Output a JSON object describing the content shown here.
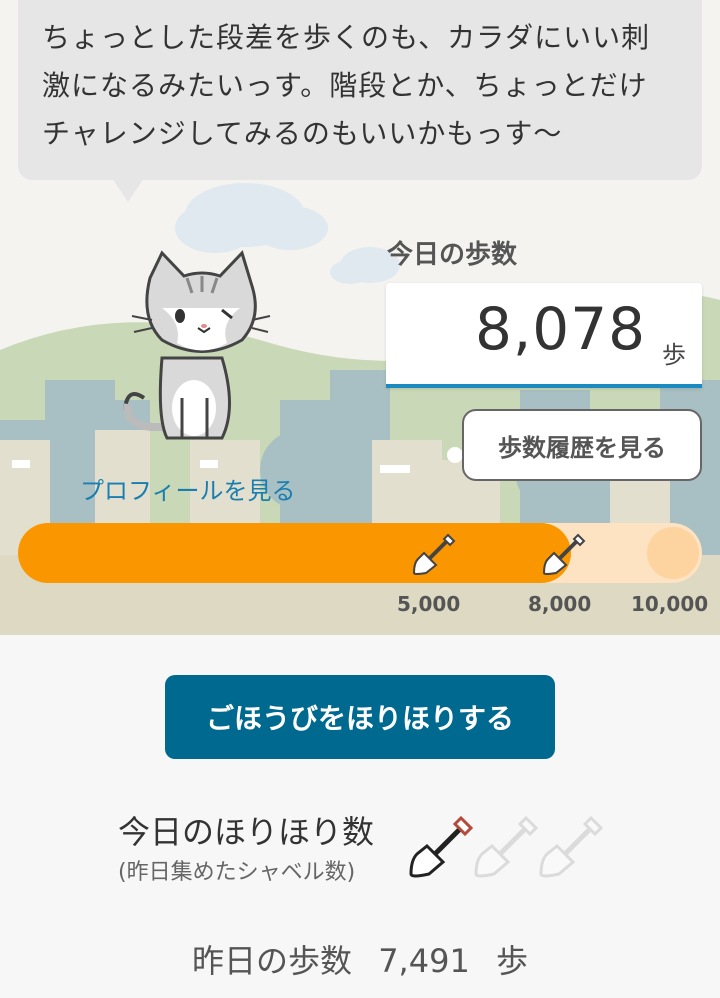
{
  "speech_bubble": {
    "lines": [
      "ちょっとした段差を歩くのも、カラダにいい刺",
      "激になるみたいっす。階段とか、ちょっとだけ",
      "チャレンジしてみるのもいいかもっす〜"
    ]
  },
  "today_steps": {
    "label": "今日の歩数",
    "value": "8,078",
    "unit": "歩"
  },
  "history_button": {
    "label": "歩数履歴を見る"
  },
  "profile_link": {
    "label": "プロフィールを見る"
  },
  "progress": {
    "current": 8078,
    "goal": 10000,
    "fraction": 0.8078,
    "milestones": [
      "5,000",
      "8,000",
      "10,000"
    ]
  },
  "dig_button": {
    "label": "ごほうびをほりほりする"
  },
  "dig_count": {
    "title": "今日のほりほり数",
    "subtitle": "(昨日集めたシャベル数)",
    "filled": 1,
    "total": 3
  },
  "yesterday": {
    "label": "昨日の歩数",
    "value": "7,491",
    "unit": "歩"
  },
  "colors": {
    "accent_orange": "#fa9600",
    "primary_button": "#00698f",
    "link": "#1a7fb0",
    "steps_underline": "#1b8ac0"
  },
  "icons": [
    "cat-mascot",
    "shovel-icon",
    "cloud"
  ]
}
